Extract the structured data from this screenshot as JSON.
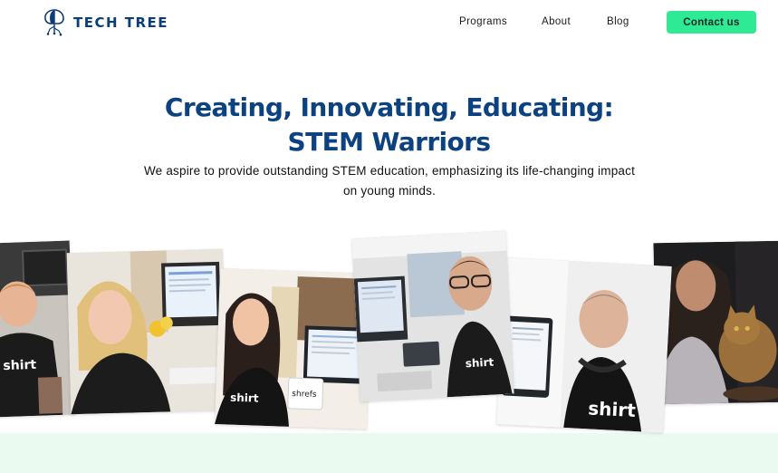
{
  "header": {
    "brand": "TECH TREE",
    "logo_icon": "tree-chip-logo-icon",
    "nav": {
      "programs": "Programs",
      "about": "About",
      "blog": "Blog"
    },
    "cta_label": "Contact us"
  },
  "hero": {
    "title_line1": "Creating, Innovating, Educating:",
    "title_line2": "STEM Warriors",
    "subtitle_line1": "We aspire to provide outstanding STEM education, emphasizing its life-changing impact",
    "subtitle_line2": "on young minds."
  },
  "photos": {
    "p3_mug_text": "shrefs",
    "shirt_text": "shirt"
  },
  "colors": {
    "brand_blue": "#0d4280",
    "cta_green": "#2eea94",
    "band_mint": "#eafaf0"
  }
}
